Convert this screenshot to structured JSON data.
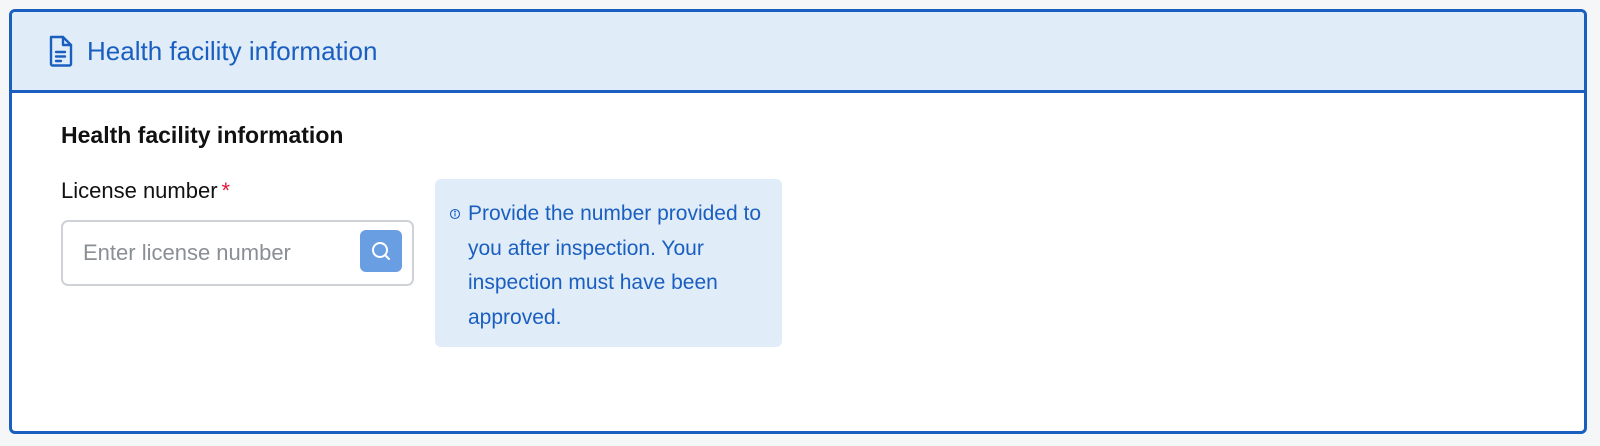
{
  "header": {
    "title": "Health facility information",
    "icon": "document-icon"
  },
  "section": {
    "title": "Health facility information"
  },
  "license_field": {
    "label": "License number",
    "required_marker": "*",
    "value": "",
    "placeholder": "Enter license number",
    "search_icon": "search-icon"
  },
  "hint": {
    "icon": "info-icon",
    "text": "Provide the number provided to you after inspection. Your inspection must have been approved."
  },
  "colors": {
    "accent": "#1a5fc0",
    "header_bg": "#e0ecf8",
    "search_button": "#6a9ee3",
    "required": "#e0193a"
  }
}
